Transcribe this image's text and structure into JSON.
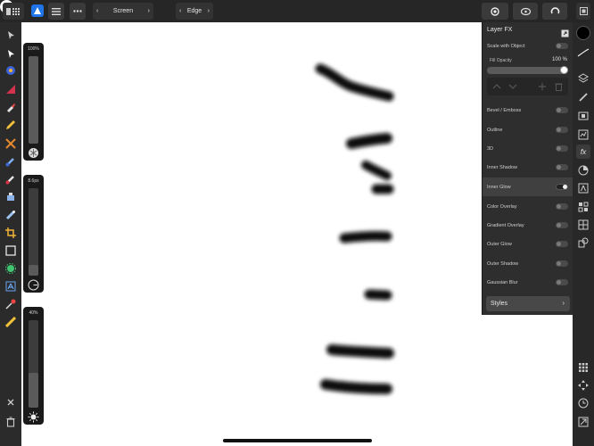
{
  "topbar": {
    "blend_mode": "Screen",
    "edge_label": "Edge",
    "prev_arrow": "‹",
    "next_arrow": "›"
  },
  "sliders": {
    "size_label": "100%",
    "size_value": 1.0,
    "opacity_label": "8.6px",
    "opacity_value": 0.12,
    "flow_label": "40%",
    "flow_value": 0.4
  },
  "panel": {
    "title": "Layer FX",
    "scale_with_object": "Scale with Object",
    "fill_opacity_label": "Fill Opacity",
    "fill_opacity_value": "100 %",
    "effects": [
      {
        "label": "Bevel / Emboss",
        "on": false
      },
      {
        "label": "Outline",
        "on": false
      },
      {
        "label": "3D",
        "on": false
      },
      {
        "label": "Inner Shadow",
        "on": false
      },
      {
        "label": "Inner Glow",
        "on": true
      },
      {
        "label": "Color Overlay",
        "on": false
      },
      {
        "label": "Gradient Overlay",
        "on": false
      },
      {
        "label": "Outer Glow",
        "on": false
      },
      {
        "label": "Outer Shadow",
        "on": false
      },
      {
        "label": "Gaussian Blur",
        "on": false
      }
    ],
    "styles_label": "Styles",
    "styles_chevron": "›"
  },
  "rightbar": {
    "fx_label": "fx"
  },
  "colors": {
    "accent": "#1f74e8",
    "panel_bg": "#2e2e2e",
    "canvas": "#ffffff"
  }
}
